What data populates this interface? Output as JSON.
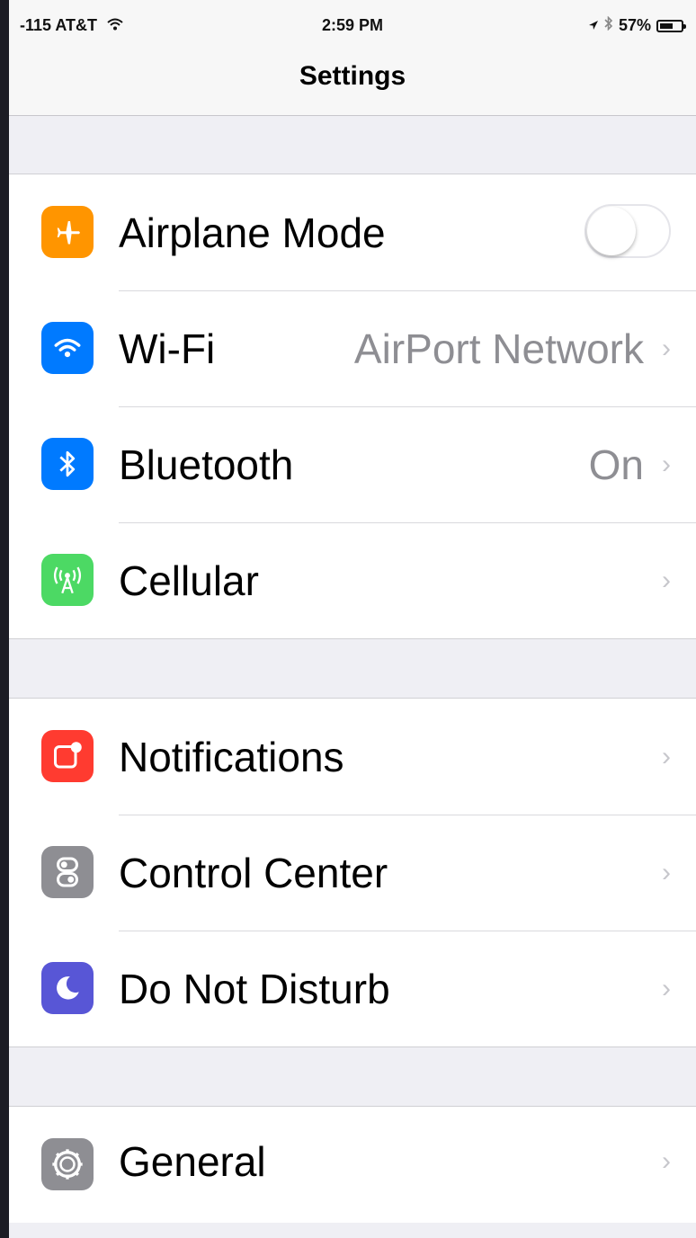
{
  "status_bar": {
    "carrier": "-115 AT&T",
    "time": "2:59 PM",
    "battery": "57%"
  },
  "nav": {
    "title": "Settings"
  },
  "colors": {
    "airplane": "#ff9500",
    "wifi": "#007aff",
    "bluetooth": "#007aff",
    "cellular": "#4cd964",
    "notifications": "#ff3b30",
    "control_center": "#8e8e93",
    "do_not_disturb": "#5856d6",
    "general": "#8e8e93"
  },
  "groups": [
    {
      "rows": [
        {
          "label": "Airplane Mode",
          "icon": "airplane-icon",
          "toggle_on": false
        },
        {
          "label": "Wi-Fi",
          "detail": "AirPort Network",
          "icon": "wifi-icon"
        },
        {
          "label": "Bluetooth",
          "detail": "On",
          "icon": "bluetooth-icon"
        },
        {
          "label": "Cellular",
          "icon": "cellular-antenna-icon"
        }
      ]
    },
    {
      "rows": [
        {
          "label": "Notifications",
          "icon": "notifications-icon"
        },
        {
          "label": "Control Center",
          "icon": "control-center-icon"
        },
        {
          "label": "Do Not Disturb",
          "icon": "moon-icon"
        }
      ]
    },
    {
      "rows": [
        {
          "label": "General",
          "icon": "gear-icon"
        }
      ]
    }
  ]
}
